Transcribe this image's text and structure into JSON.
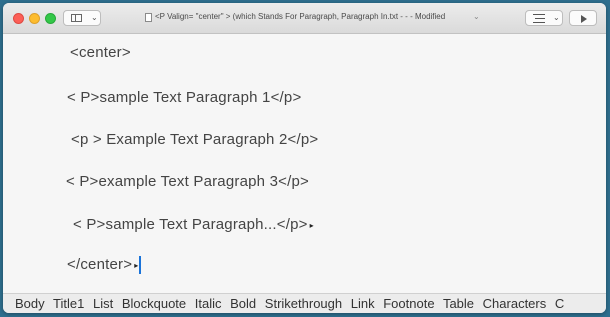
{
  "window": {
    "title": "<P Valign= \"center\" > (which Stands For Paragraph, Paragraph In.txt - - - Modified",
    "buttons": {
      "close": "close",
      "minimize": "minimize",
      "maximize": "maximize"
    }
  },
  "editor": {
    "lines": [
      "<center>",
      "< P>sample Text Paragraph 1</p>",
      "<p > Example Text Paragraph 2</p>",
      "< P>example Text Paragraph 3</p>",
      "< P>sample Text Paragraph...</p>",
      "</center>"
    ]
  },
  "format_bar": {
    "items": [
      "Body",
      "Title1",
      "List",
      "Blockquote",
      "Italic",
      "Bold",
      "Strikethrough",
      "Link",
      "Footnote",
      "Table",
      "Characters",
      "C"
    ]
  },
  "icons": {
    "sidebar_toggle": "sidebar-icon",
    "document": "document-icon",
    "list_style": "list-icon",
    "preview": "play-icon"
  },
  "colors": {
    "cursor": "#1a73d9",
    "close": "#fc5f57",
    "minimize": "#fdbc2e",
    "maximize": "#33c748"
  }
}
